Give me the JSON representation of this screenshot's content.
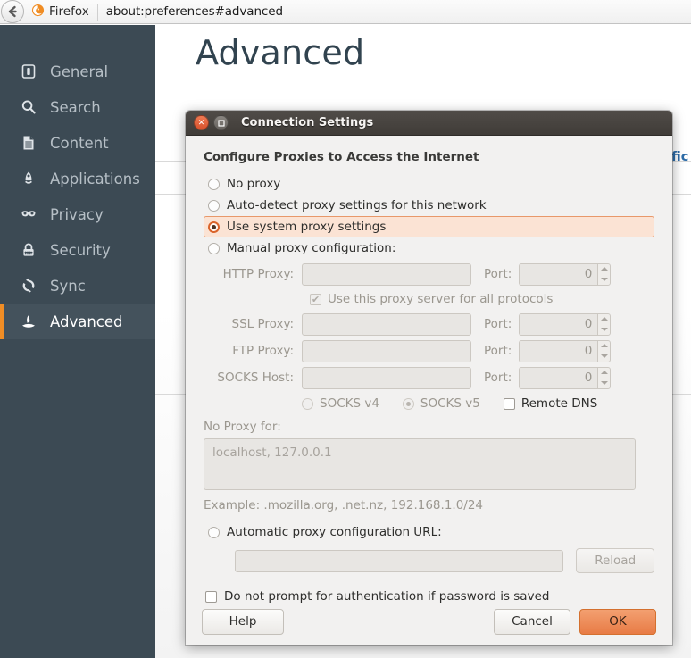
{
  "browser": {
    "back_icon": "back-arrow-icon",
    "brand_icon": "firefox-logo-icon",
    "brand_label": "Firefox",
    "url": "about:preferences#advanced"
  },
  "sidebar": {
    "items": [
      {
        "label": "General",
        "icon": "general-icon",
        "selected": false
      },
      {
        "label": "Search",
        "icon": "search-icon",
        "selected": false
      },
      {
        "label": "Content",
        "icon": "content-icon",
        "selected": false
      },
      {
        "label": "Applications",
        "icon": "applications-icon",
        "selected": false
      },
      {
        "label": "Privacy",
        "icon": "privacy-mask-icon",
        "selected": false
      },
      {
        "label": "Security",
        "icon": "lock-icon",
        "selected": false
      },
      {
        "label": "Sync",
        "icon": "sync-icon",
        "selected": false
      },
      {
        "label": "Advanced",
        "icon": "advanced-icon",
        "selected": true
      }
    ],
    "accent_color": "#f08d25",
    "background_color": "#3c4a54"
  },
  "page": {
    "title": "Advanced",
    "partial_tab_text": "ific"
  },
  "dialog": {
    "title": "Connection Settings",
    "close_icon": "close-icon",
    "maximize_icon": "maximize-icon",
    "heading": "Configure Proxies to Access the Internet",
    "proxy_mode_options": [
      {
        "label": "No proxy",
        "accesskey": "y",
        "selected": false,
        "focused": false
      },
      {
        "label": "Auto-detect proxy settings for this network",
        "accesskey": "w",
        "selected": false,
        "focused": false
      },
      {
        "label": "Use system proxy settings",
        "accesskey": "U",
        "selected": true,
        "focused": true
      },
      {
        "label": "Manual proxy configuration:",
        "accesskey": "M",
        "selected": false,
        "focused": false
      }
    ],
    "manual": {
      "enabled": false,
      "fields": [
        {
          "label": "HTTP Proxy:",
          "value": "",
          "port_label": "Port:",
          "port_value": "0"
        },
        {
          "label": "SSL Proxy:",
          "value": "",
          "port_label": "Port:",
          "port_value": "0"
        },
        {
          "label": "FTP Proxy:",
          "value": "",
          "port_label": "Port:",
          "port_value": "0"
        },
        {
          "label": "SOCKS Host:",
          "value": "",
          "port_label": "Port:",
          "port_value": "0"
        }
      ],
      "all_protocols_label": "Use this proxy server for all protocols",
      "all_protocols_checked": true,
      "socks_v4_label": "SOCKS v4",
      "socks_v4_selected": false,
      "socks_v5_label": "SOCKS v5",
      "socks_v5_selected": true,
      "remote_dns_label": "Remote DNS",
      "remote_dns_checked": false,
      "no_proxy_label": "No Proxy for:",
      "no_proxy_value": "localhost, 127.0.0.1",
      "no_proxy_example": "Example: .mozilla.org, .net.nz, 192.168.1.0/24"
    },
    "pac": {
      "label": "Automatic proxy configuration URL:",
      "url_value": "",
      "reload_label": "Reload",
      "selected": false
    },
    "no_prompt_label": "Do not prompt for authentication if password is saved",
    "no_prompt_checked": false,
    "buttons": {
      "help": "Help",
      "cancel": "Cancel",
      "ok": "OK"
    },
    "ok_color": "#e87b45",
    "focus_color": "#e8986a"
  }
}
